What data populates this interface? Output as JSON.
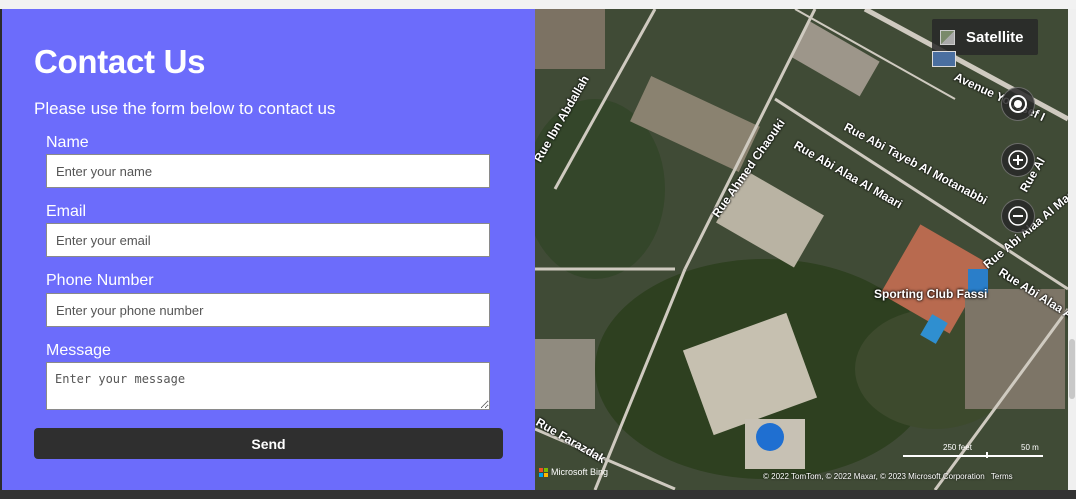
{
  "contact": {
    "title": "Contact Us",
    "subtitle": "Please use the form below to contact us",
    "name_label": "Name",
    "name_placeholder": "Enter your name",
    "email_label": "Email",
    "email_placeholder": "Enter your email",
    "phone_label": "Phone Number",
    "phone_placeholder": "Enter your phone number",
    "message_label": "Message",
    "message_placeholder": "Enter your message",
    "send_label": "Send"
  },
  "map": {
    "map_type": "Satellite",
    "map_type_icon": "satellite-icon",
    "locate_icon": "locate-icon",
    "zoom_in_icon": "plus-icon",
    "zoom_out_icon": "minus-icon",
    "streets": [
      "Avenue Youssef I",
      "Rue Abi Tayeb Al Motanabbi",
      "Rue Ahmed Chaouki",
      "Rue Abi Alaa Al Maari",
      "Rue Abi Alaa Al Maari",
      "Rue Abi Alaa Al Maari",
      "Rue Farazdak",
      "Rue Ibn Abdallah",
      "Rue Al"
    ],
    "poi": "Sporting Club Fassi",
    "scale_feet": "250 feet",
    "scale_m": "50 m",
    "brand": "Microsoft Bing",
    "attribution": "© 2022 TomTom, © 2022 Maxar, © 2023 Microsoft Corporation",
    "terms": "Terms"
  },
  "colors": {
    "panel_bg": "#6c6cfb",
    "button_bg": "#2f2f2f",
    "footer_bar": "#333333"
  }
}
